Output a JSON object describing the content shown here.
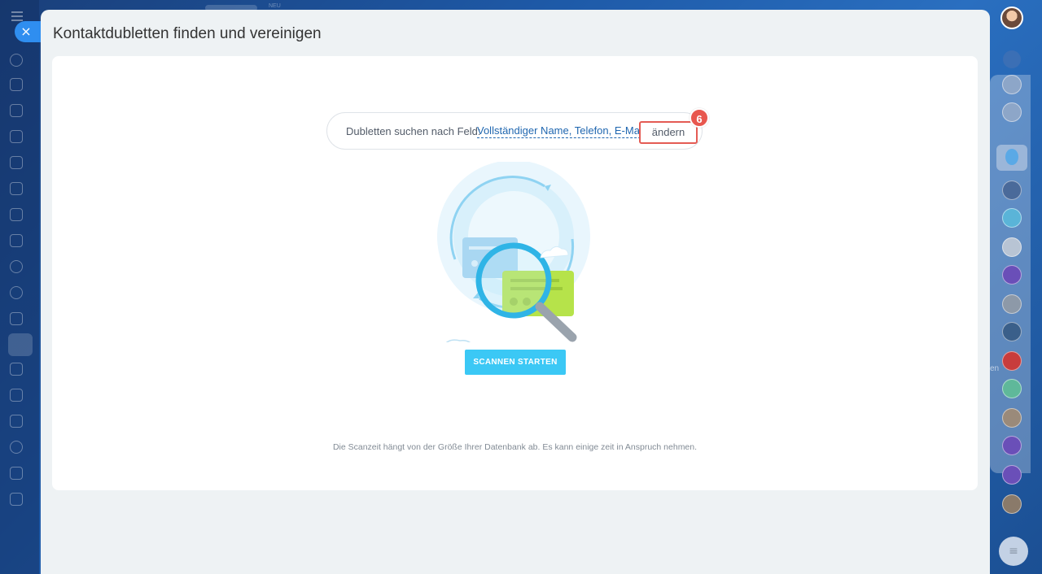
{
  "window": {
    "title": "Kontaktdubletten finden und vereinigen",
    "close_symbol": "×",
    "top_badge": "NEU"
  },
  "search": {
    "label": "Dubletten suchen nach Feld:",
    "fields_value": "Vollständiger Name, Telefon, E-Mail",
    "change_label": "ändern",
    "step_number": "6"
  },
  "actions": {
    "scan_label": "SCANNEN STARTEN"
  },
  "hint": "Die Scanzeit hängt von der Größe Ihrer Datenbank ab. Es kann einige zeit in Anspruch nehmen.",
  "right_rail": {
    "partial_label": "en",
    "chat_symbol": "≡",
    "bell_symbol": "🔔"
  },
  "colors": {
    "accent": "#3bc8f5",
    "link": "#2067b0",
    "highlight": "#e45b54"
  }
}
